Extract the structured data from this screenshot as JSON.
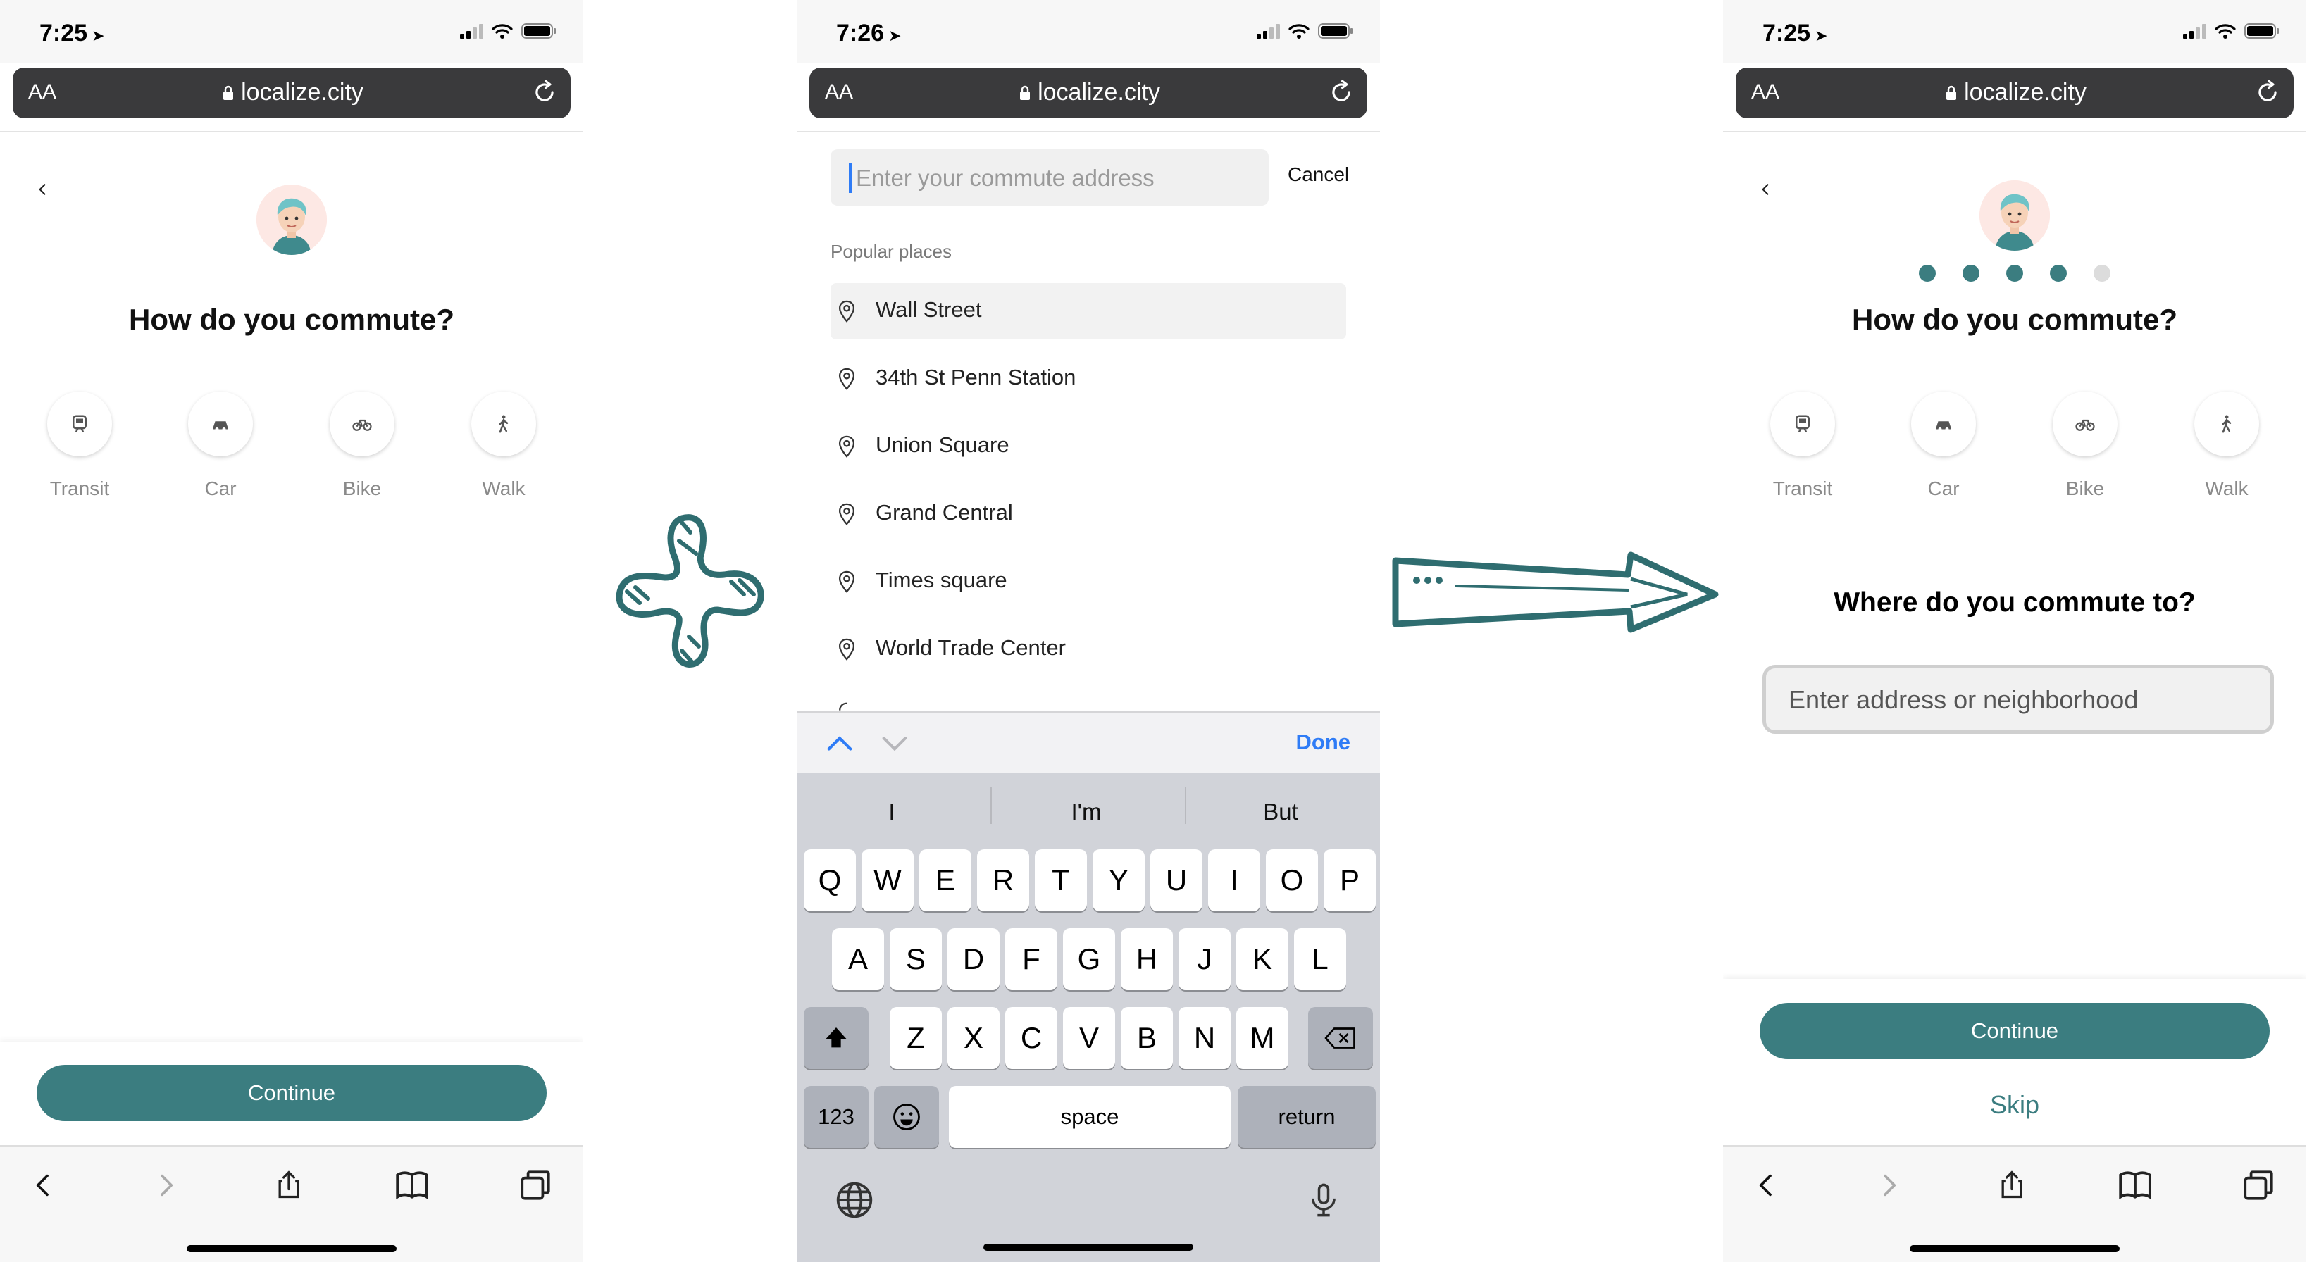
{
  "browser": {
    "url": "localize.city",
    "text_size_label": "AA"
  },
  "left_screen": {
    "status_time": "7:25",
    "title": "How do you commute?",
    "modes": [
      {
        "label": "Transit",
        "icon": "train-icon"
      },
      {
        "label": "Car",
        "icon": "car-icon"
      },
      {
        "label": "Bike",
        "icon": "bike-icon"
      },
      {
        "label": "Walk",
        "icon": "walk-icon"
      }
    ],
    "continue_label": "Continue"
  },
  "middle_screen": {
    "status_time": "7:26",
    "search_placeholder": "Enter your commute address",
    "cancel_label": "Cancel",
    "section_label": "Popular places",
    "places": [
      "Wall Street",
      "34th St Penn Station",
      "Union Square",
      "Grand Central",
      "Times square",
      "World Trade Center"
    ],
    "done_label": "Done",
    "suggestions": [
      "I",
      "I'm",
      "But"
    ],
    "keyboard_rows": [
      [
        "Q",
        "W",
        "E",
        "R",
        "T",
        "Y",
        "U",
        "I",
        "O",
        "P"
      ],
      [
        "A",
        "S",
        "D",
        "F",
        "G",
        "H",
        "J",
        "K",
        "L"
      ],
      [
        "Z",
        "X",
        "C",
        "V",
        "B",
        "N",
        "M"
      ]
    ],
    "key_123": "123",
    "key_space": "space",
    "key_return": "return"
  },
  "right_screen": {
    "status_time": "7:25",
    "title": "How do you commute?",
    "progress": {
      "total": 5,
      "completed": 4
    },
    "modes": [
      {
        "label": "Transit",
        "icon": "train-icon"
      },
      {
        "label": "Car",
        "icon": "car-icon"
      },
      {
        "label": "Bike",
        "icon": "bike-icon"
      },
      {
        "label": "Walk",
        "icon": "walk-icon"
      }
    ],
    "subtitle": "Where do you commute to?",
    "address_placeholder": "Enter address or neighborhood",
    "continue_label": "Continue",
    "skip_label": "Skip"
  },
  "colors": {
    "brand_teal": "#3b7d80",
    "ios_blue": "#2f7cf6",
    "url_bar": "#3a3a3c"
  }
}
